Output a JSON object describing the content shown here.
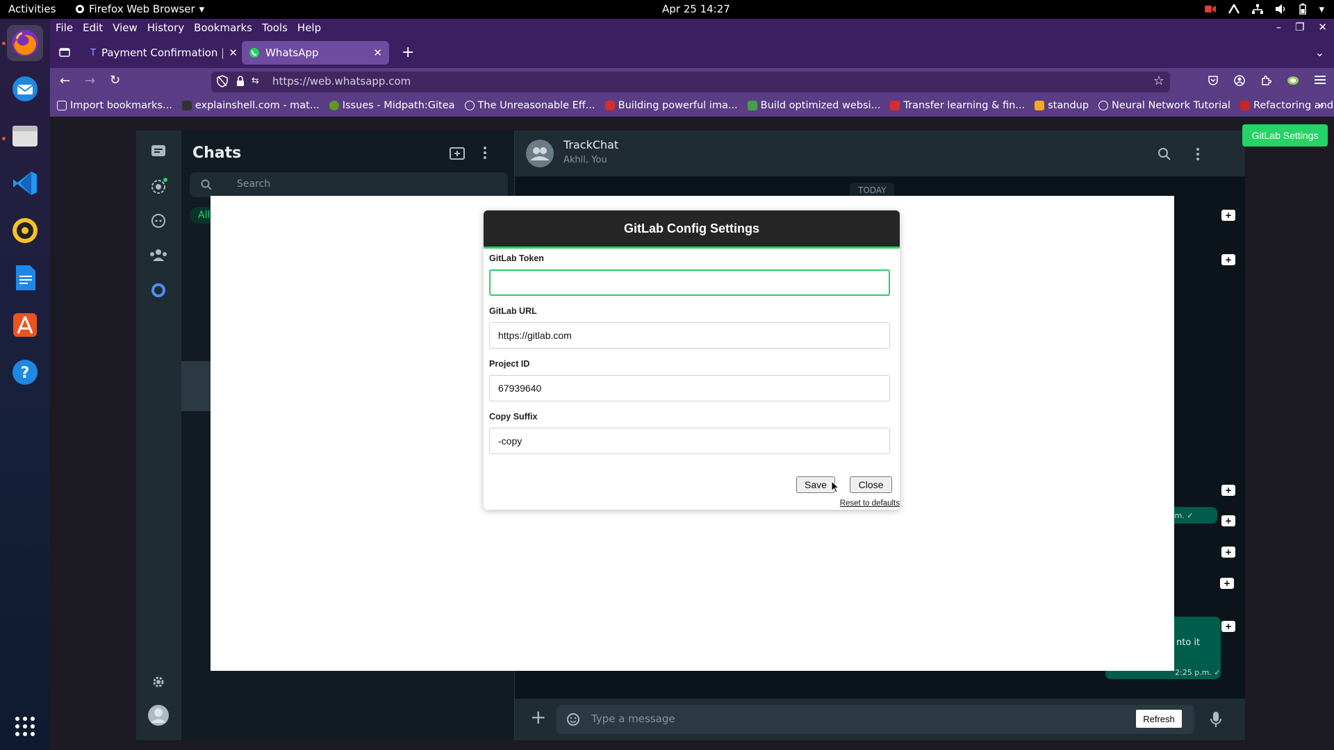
{
  "system": {
    "activities": "Activities",
    "app_name": "Firefox Web Browser",
    "clock": "Apr 25  14:27"
  },
  "firefox": {
    "menu": [
      "File",
      "Edit",
      "View",
      "History",
      "Bookmarks",
      "Tools",
      "Help"
    ],
    "tabs": [
      {
        "title": "Payment Confirmation | T"
      },
      {
        "title": "WhatsApp"
      }
    ],
    "url": "https://web.whatsapp.com",
    "bookmarks": [
      {
        "label": "Import bookmarks...",
        "color": "#ffffff"
      },
      {
        "label": "explainshell.com - mat...",
        "color": "#ffffff"
      },
      {
        "label": "Issues - Midpath:Gitea",
        "color": "#609926"
      },
      {
        "label": "The Unreasonable Eff...",
        "color": "#ffffff"
      },
      {
        "label": "Building powerful ima...",
        "color": "#d32f2f"
      },
      {
        "label": "Build optimized websi...",
        "color": "#43a047"
      },
      {
        "label": "Transfer learning & fin...",
        "color": "#d32f2f"
      },
      {
        "label": "standup",
        "color": "#f9a825"
      },
      {
        "label": "Neural Network Tutorial",
        "color": "#ffffff"
      },
      {
        "label": "Refactoring and Desig...",
        "color": "#c62828"
      }
    ]
  },
  "whatsapp": {
    "chats_title": "Chats",
    "search_placeholder": "Search",
    "filter_all": "All",
    "chat_name": "TrackChat",
    "chat_members": "Akhil, You",
    "date_divider": "TODAY",
    "msg_fragment_time": "p.m. ✓",
    "msg_fragment_text": "nto it",
    "msg_time": "2:25 p.m. ✓",
    "message_placeholder": "Type a message",
    "refresh_label": "Refresh",
    "gitlab_settings_label": "GitLab Settings"
  },
  "dialog": {
    "title": "GitLab Config Settings",
    "fields": [
      {
        "label": "GitLab Token",
        "value": ""
      },
      {
        "label": "GitLab URL",
        "value": "https://gitlab.com"
      },
      {
        "label": "Project ID",
        "value": "67939640"
      },
      {
        "label": "Copy Suffix",
        "value": "-copy"
      }
    ],
    "save_label": "Save",
    "close_label": "Close",
    "reset_label": "Reset to defaults"
  },
  "colors": {
    "accent_green": "#25d366",
    "firefox_purple": "#3b1f60"
  }
}
